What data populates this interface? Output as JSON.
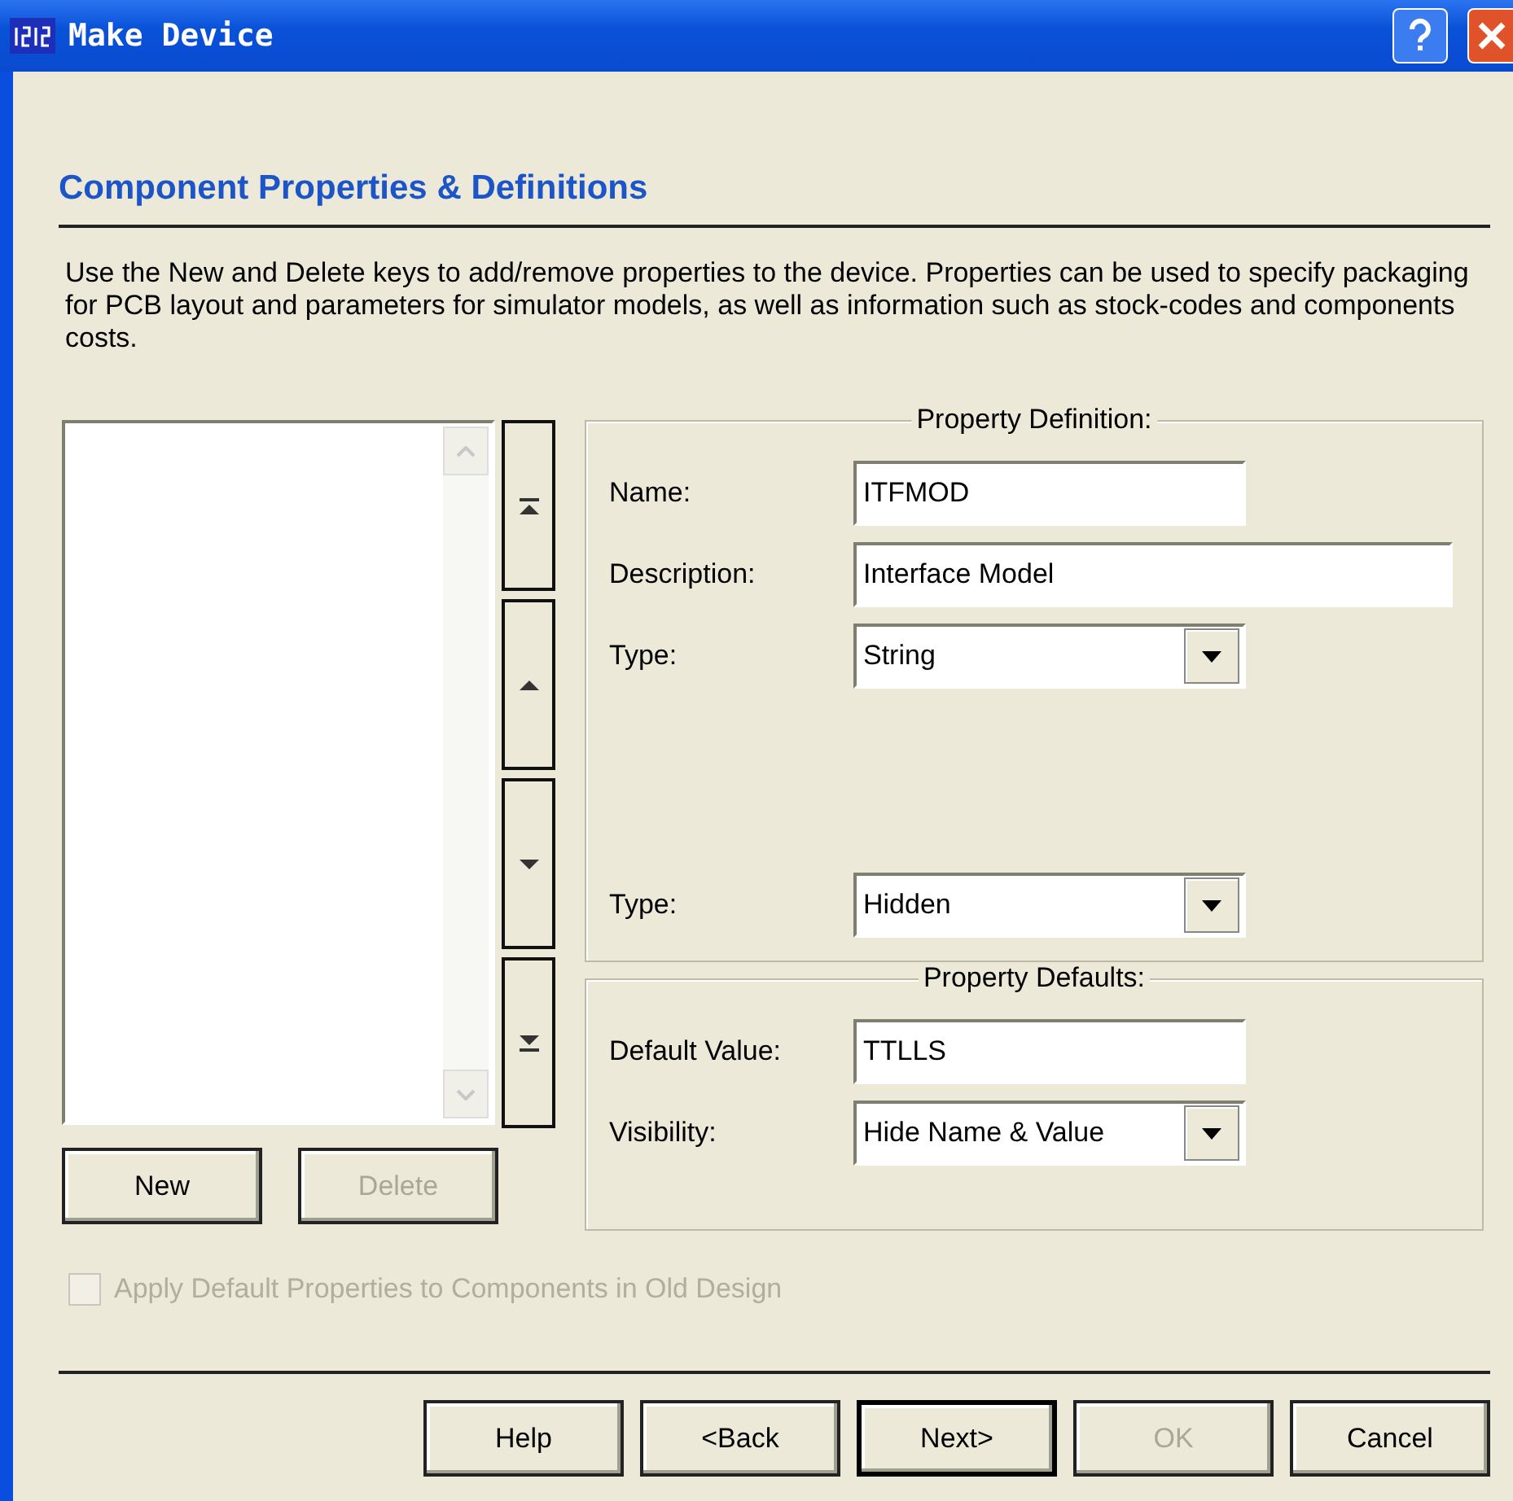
{
  "window": {
    "title": "Make Device"
  },
  "header": {
    "title": "Component Properties & Definitions",
    "description": "Use the New and Delete keys to add/remove properties to the device. Properties can be used to specify packaging for PCB layout and parameters for simulator models, as well as information such as stock-codes and components costs."
  },
  "list_buttons": [
    {
      "label": "New",
      "disabled": false
    },
    {
      "label": "Delete",
      "disabled": true
    }
  ],
  "property_definition": {
    "title": "Property Definition:",
    "fields": [
      {
        "label": "Name:",
        "value": "ITFMOD",
        "kind": "text",
        "wide": false
      },
      {
        "label": "Description:",
        "value": "Interface Model",
        "kind": "text",
        "wide": true
      },
      {
        "label": "Type:",
        "value": "String",
        "kind": "dropdown",
        "wide": false
      }
    ],
    "bottom_fields": [
      {
        "label": "Type:",
        "value": "Hidden",
        "kind": "dropdown",
        "wide": false
      }
    ]
  },
  "property_defaults": {
    "title": "Property Defaults:",
    "fields": [
      {
        "label": "Default Value:",
        "value": "TTLLS",
        "kind": "text",
        "wide": false
      },
      {
        "label": "Visibility:",
        "value": "Hide Name & Value",
        "kind": "dropdown",
        "wide": false
      }
    ]
  },
  "apply_checkbox": {
    "label": "Apply Default Properties to Components in Old Design",
    "checked": false,
    "disabled": true
  },
  "footer_buttons": [
    {
      "label": "Help",
      "disabled": false,
      "default": false
    },
    {
      "label": "<Back",
      "disabled": false,
      "default": false
    },
    {
      "label": "Next>",
      "disabled": false,
      "default": true
    },
    {
      "label": "OK",
      "disabled": true,
      "default": false
    },
    {
      "label": "Cancel",
      "disabled": false,
      "default": false
    }
  ]
}
